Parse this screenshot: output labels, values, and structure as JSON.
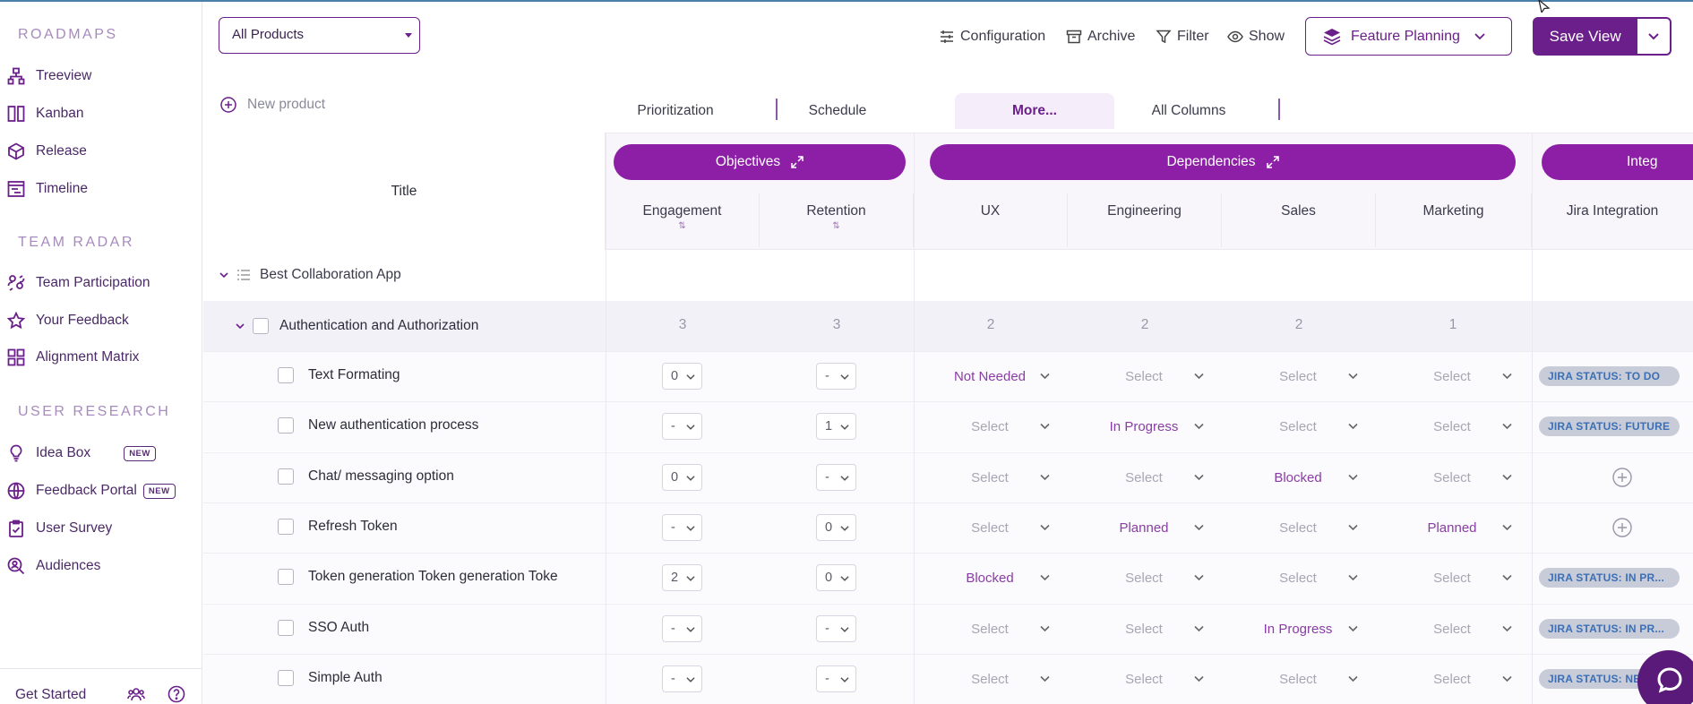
{
  "sidebar": {
    "sections": [
      {
        "title": "ROADMAPS",
        "items": [
          {
            "label": "Treeview",
            "icon": "treeview-icon"
          },
          {
            "label": "Kanban",
            "icon": "kanban-icon"
          },
          {
            "label": "Release",
            "icon": "release-cube-icon"
          },
          {
            "label": "Timeline",
            "icon": "timeline-icon"
          }
        ]
      },
      {
        "title": "TEAM RADAR",
        "items": [
          {
            "label": "Team Participation",
            "icon": "team-participation-icon"
          },
          {
            "label": "Your Feedback",
            "icon": "star-icon"
          },
          {
            "label": "Alignment Matrix",
            "icon": "grid-icon"
          }
        ]
      },
      {
        "title": "USER RESEARCH",
        "items": [
          {
            "label": "Idea Box",
            "icon": "lightbulb-icon",
            "badge": "NEW"
          },
          {
            "label": "Feedback Portal",
            "icon": "globe-icon",
            "badge": "NEW"
          },
          {
            "label": "User Survey",
            "icon": "clipboard-check-icon"
          },
          {
            "label": "Audiences",
            "icon": "audience-search-icon"
          }
        ]
      }
    ],
    "get_started": "Get Started"
  },
  "toolbar": {
    "product_select": "All Products",
    "configuration": "Configuration",
    "archive": "Archive",
    "filter": "Filter",
    "show": "Show",
    "feature_planning": "Feature Planning",
    "save_view": "Save View"
  },
  "tabs": {
    "new_product": "New product",
    "items": [
      "Prioritization",
      "Schedule",
      "More...",
      "All Columns"
    ],
    "active": "More..."
  },
  "table": {
    "title_header": "Title",
    "groups": [
      "Objectives",
      "Dependencies",
      "Integ"
    ],
    "columns": [
      "Engagement",
      "Retention",
      "UX",
      "Engineering",
      "Sales",
      "Marketing",
      "Jira Integration"
    ],
    "parent": "Best Collaboration App",
    "subgroup": {
      "title": "Authentication and Authorization",
      "counts": [
        "3",
        "3",
        "2",
        "2",
        "2",
        "1"
      ]
    },
    "rows": [
      {
        "title": "Text Formating",
        "engagement": "0",
        "retention": "-",
        "ux": "Not Needed",
        "engineering": "Select",
        "sales": "Select",
        "marketing": "Select",
        "jira": "JIRA STATUS: TO DO"
      },
      {
        "title": "New authentication process",
        "engagement": "-",
        "retention": "1",
        "ux": "Select",
        "engineering": "In Progress",
        "sales": "Select",
        "marketing": "Select",
        "jira": "JIRA STATUS: FUTURE"
      },
      {
        "title": "Chat/ messaging option",
        "engagement": "0",
        "retention": "-",
        "ux": "Select",
        "engineering": "Select",
        "sales": "Blocked",
        "marketing": "Select",
        "jira": ""
      },
      {
        "title": "Refresh Token",
        "engagement": "-",
        "retention": "0",
        "ux": "Select",
        "engineering": "Planned",
        "sales": "Select",
        "marketing": "Planned",
        "jira": ""
      },
      {
        "title": "Token generation Token generation Toke",
        "engagement": "2",
        "retention": "0",
        "ux": "Blocked",
        "engineering": "Select",
        "sales": "Select",
        "marketing": "Select",
        "jira": "JIRA STATUS: IN PR..."
      },
      {
        "title": "SSO Auth",
        "engagement": "-",
        "retention": "-",
        "ux": "Select",
        "engineering": "Select",
        "sales": "In Progress",
        "marketing": "Select",
        "jira": "JIRA STATUS: IN PR..."
      },
      {
        "title": "Simple Auth",
        "engagement": "-",
        "retention": "-",
        "ux": "Select",
        "engineering": "Select",
        "sales": "Select",
        "marketing": "Select",
        "jira": "JIRA STATUS: NE"
      }
    ]
  },
  "colors": {
    "brand": "#6b1f8a",
    "pill": "#8c1fa5",
    "jira_text": "#3b6fb6"
  }
}
